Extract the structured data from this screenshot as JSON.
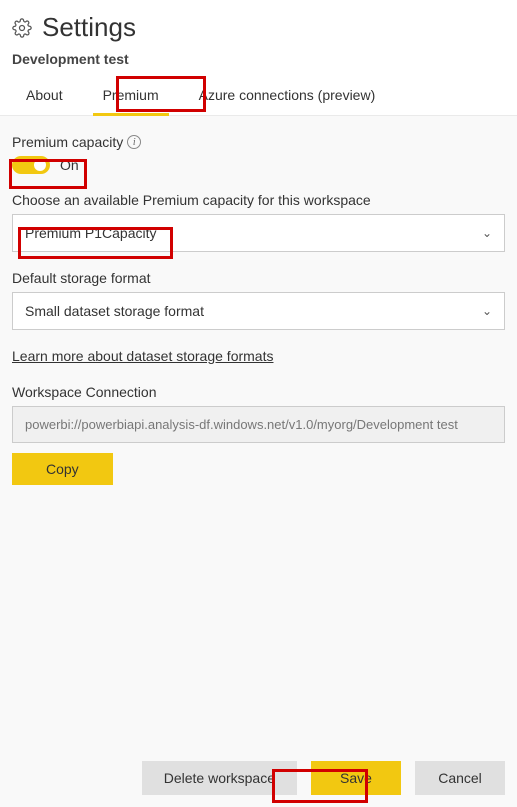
{
  "header": {
    "title": "Settings",
    "subtitle": "Development test"
  },
  "tabs": {
    "about": "About",
    "premium": "Premium",
    "azure": "Azure connections (preview)"
  },
  "premium": {
    "capacity_label": "Premium capacity",
    "toggle_state": "On",
    "choose_label": "Choose an available Premium capacity for this workspace",
    "capacity_value": "Premium  P1Capacity",
    "storage_label": "Default storage format",
    "storage_value": "Small dataset storage format",
    "learn_link": "Learn more about dataset storage formats",
    "connection_label": "Workspace Connection",
    "connection_value": "powerbi://powerbiapi.analysis-df.windows.net/v1.0/myorg/Development test",
    "copy_label": "Copy"
  },
  "footer": {
    "delete": "Delete workspace",
    "save": "Save",
    "cancel": "Cancel"
  }
}
